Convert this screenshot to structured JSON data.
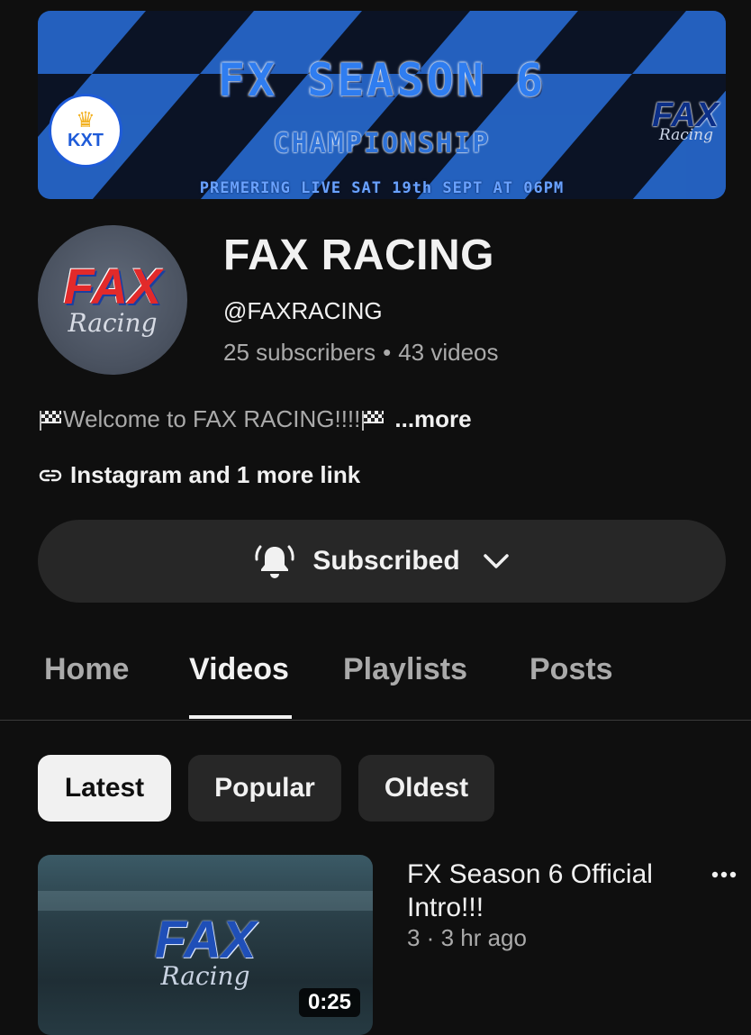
{
  "banner": {
    "title": "FX SEASON 6",
    "subtitle": "CHAMPIONSHIP",
    "premiere_text": "PREMERING LIVE SAT 19th SEPT AT 06PM",
    "badge_text": "KXT",
    "logo_main": "FAX",
    "logo_script": "Racing",
    "colors": {
      "check_blue": "#2f7df0",
      "check_dark": "#0b0f18"
    }
  },
  "channel": {
    "avatar_main": "FAX",
    "avatar_script": "Racing",
    "name": "FAX RACING",
    "handle": "@FAXRACING",
    "subscribers": "25 subscribers",
    "separator": "•",
    "videos": "43 videos",
    "description": "Welcome to FAX RACING!!!!",
    "more_label": "...more",
    "links_label": "Instagram and 1 more link"
  },
  "subscribe": {
    "label": "Subscribed",
    "bell_icon": "bell-ringing-icon",
    "chevron_icon": "chevron-down-icon"
  },
  "tabs": [
    {
      "label": "Home",
      "active": false
    },
    {
      "label": "Videos",
      "active": true
    },
    {
      "label": "Playlists",
      "active": false
    },
    {
      "label": "Posts",
      "active": false
    }
  ],
  "chips": [
    {
      "label": "Latest",
      "active": true
    },
    {
      "label": "Popular",
      "active": false
    },
    {
      "label": "Oldest",
      "active": false
    }
  ],
  "videos": [
    {
      "title": "FX Season 6 Official Intro!!!",
      "meta": "3 · 3 hr ago",
      "duration": "0:25",
      "thumb_main": "FAX",
      "thumb_script": "Racing"
    }
  ]
}
